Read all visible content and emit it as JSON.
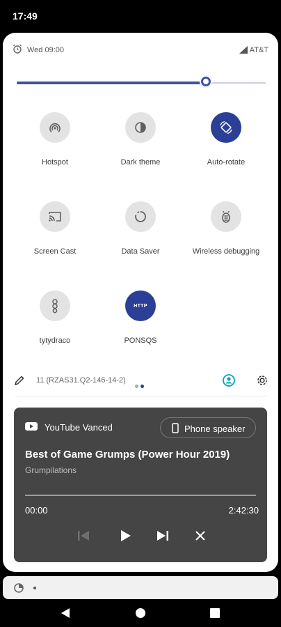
{
  "status_bar": {
    "time": "17:49"
  },
  "header": {
    "date": "Wed 09:00",
    "carrier": "AT&T"
  },
  "brightness": {
    "level": 0.76
  },
  "tiles": [
    {
      "label": "Hotspot",
      "state": "off",
      "icon": "hotspot-icon"
    },
    {
      "label": "Dark theme",
      "state": "off",
      "icon": "dark-theme-icon"
    },
    {
      "label": "Auto-rotate",
      "state": "on",
      "icon": "auto-rotate-icon"
    },
    {
      "label": "Screen Cast",
      "state": "off",
      "icon": "cast-icon"
    },
    {
      "label": "Data Saver",
      "state": "off",
      "icon": "data-saver-icon"
    },
    {
      "label": "Wireless debugging",
      "state": "off",
      "icon": "bug-icon"
    },
    {
      "label": "tytydraco",
      "state": "off",
      "icon": "tytydraco-icon"
    },
    {
      "label": "PONSQS",
      "state": "on",
      "icon": "http-icon",
      "icon_text": "HTTP"
    }
  ],
  "footer": {
    "build": "11 (RZAS31.Q2-146-14-2)"
  },
  "media": {
    "app": "YouTube Vanced",
    "output": "Phone speaker",
    "title": "Best of Game Grumps (Power Hour 2019)",
    "artist": "Grumpilations",
    "position": "00:00",
    "duration": "2:42:30",
    "progress": 0
  },
  "colors": {
    "accent": "#2a3f95",
    "slider": "#3f51a3",
    "media_bg": "#454545",
    "user_icon": "#00a3c4"
  }
}
